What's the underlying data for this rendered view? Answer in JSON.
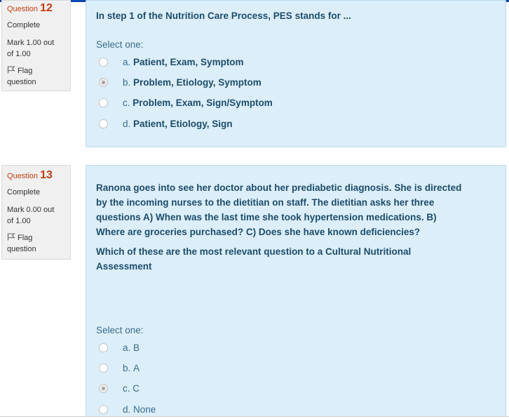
{
  "questions": [
    {
      "qno_prefix": "Question",
      "qno": "12",
      "state": "Complete",
      "grade_line1": "Mark 1.00 out",
      "grade_line2": "of 1.00",
      "flag_line1": "Flag",
      "flag_line2": "question",
      "qtext": [
        "In step 1 of the Nutrition Care Process, PES stands for ..."
      ],
      "prompt": "Select one:",
      "answers": [
        {
          "letter": "a. ",
          "text": "Patient, Exam, Symptom",
          "checked": false
        },
        {
          "letter": "b. ",
          "text": "Problem, Etiology, Symptom",
          "checked": true
        },
        {
          "letter": "c. ",
          "text": "Problem, Exam, Sign/Symptom",
          "checked": false
        },
        {
          "letter": "d. ",
          "text": "Patient, Etiology, Sign",
          "checked": false
        }
      ]
    },
    {
      "qno_prefix": "Question",
      "qno": "13",
      "state": "Complete",
      "grade_line1": "Mark 0.00 out",
      "grade_line2": "of 1.00",
      "flag_line1": "Flag",
      "flag_line2": "question",
      "qtext": [
        "Ranona goes into see her doctor about her prediabetic diagnosis. She is directed",
        "by the incoming nurses to the dietitian on staff. The dietitian asks her three",
        "questions A) When was the last time she took hypertension medications. B)",
        "Where are groceries purchased? C) Does she have known deficiencies?",
        "Which of these are the most relevant question to a  Cultural Nutritional",
        "Assessment"
      ],
      "prompt": "Select one:",
      "answers": [
        {
          "letter": "a. ",
          "text": "B",
          "checked": false
        },
        {
          "letter": "b. ",
          "text": "A",
          "checked": false
        },
        {
          "letter": "c. ",
          "text": "C",
          "checked": true
        },
        {
          "letter": "d. ",
          "text": "None",
          "checked": false
        }
      ]
    }
  ],
  "colors": {
    "accent": "#c43d0e",
    "formulation_bg": "#dceef9",
    "question_text": "#1c4c6b",
    "top_bar": "#0f47ad"
  },
  "icons": {
    "flag": "flag-icon",
    "radio": "radio-button"
  }
}
